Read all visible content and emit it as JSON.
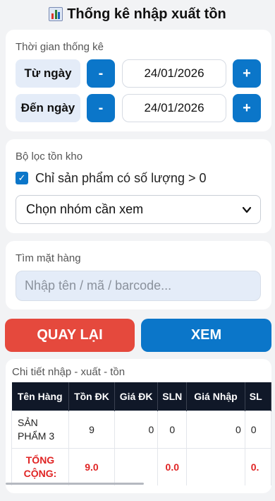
{
  "page": {
    "title": "Thống kê nhập xuất tồn",
    "title_icon": "bar-chart-icon"
  },
  "time_card": {
    "label": "Thời gian thống kê",
    "from": {
      "label": "Từ ngày",
      "value": "24/01/2026"
    },
    "to": {
      "label": "Đến ngày",
      "value": "24/01/2026"
    },
    "minus_label": "-",
    "plus_label": "+"
  },
  "filter_card": {
    "label": "Bộ lọc tồn kho",
    "checkbox_label": "Chỉ sản phẩm có số lượng > 0",
    "checkbox_checked": true,
    "group_select_value": "Chọn nhóm cần xem"
  },
  "search_card": {
    "label": "Tìm mặt hàng",
    "placeholder": "Nhập tên / mã / barcode..."
  },
  "buttons": {
    "back_label": "QUAY LẠI",
    "view_label": "XEM"
  },
  "detail": {
    "label": "Chi tiết nhập - xuất - tồn",
    "columns": [
      "Tên Hàng",
      "Tồn ĐK",
      "Giá ĐK",
      "SLN",
      "Giá Nhập",
      "SL"
    ],
    "row": {
      "name": "SẢN PHẨM 3",
      "ton_dk": "9",
      "gia_dk": "0",
      "sln": "0",
      "gia_nhap": "0",
      "sl": "0"
    },
    "total": {
      "label": "TỔNG CỘNG:",
      "ton_dk": "9.0",
      "gia_dk": "",
      "sln": "0.0",
      "gia_nhap": "",
      "sl": "0."
    }
  },
  "colors": {
    "primary": "#0b76c9",
    "danger": "#e5493d",
    "total_text": "#e02424",
    "table_header": "#101828"
  }
}
